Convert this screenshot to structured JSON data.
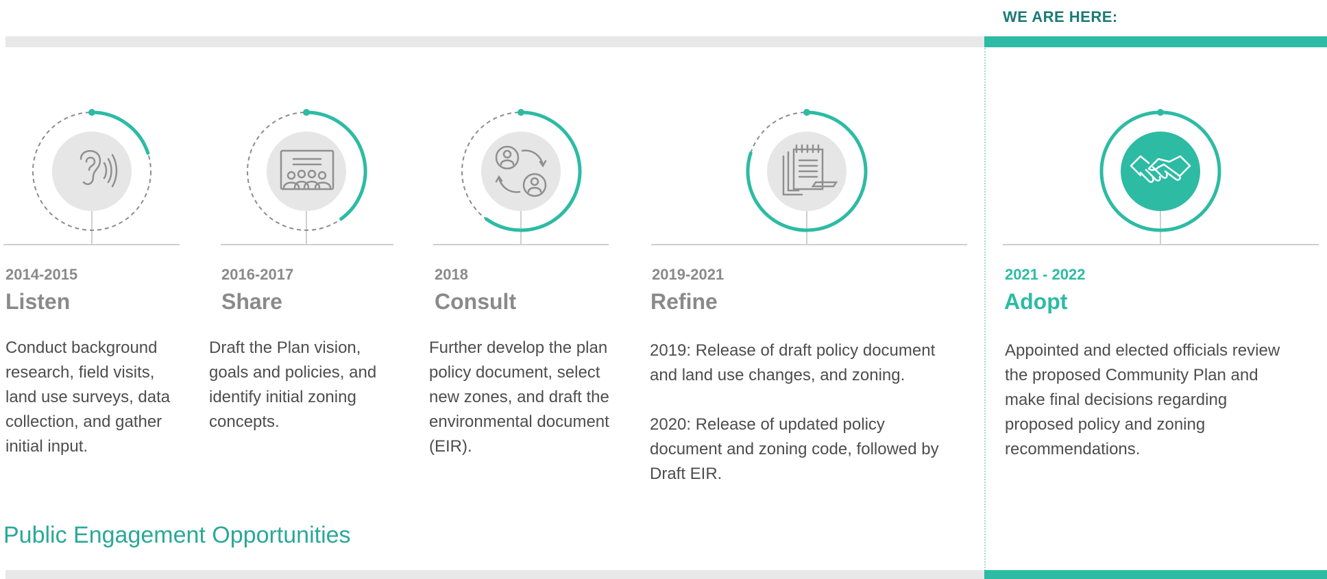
{
  "header": {
    "we_are_here": "WE ARE HERE:"
  },
  "stages": [
    {
      "years": "2014-2015",
      "title": "Listen",
      "icon": "ear-listen-icon",
      "description": "Conduct background research, field visits, land use surveys, data collection, and gather initial input.",
      "description_lines": [
        "Conduct background",
        "research, field visits,",
        "land use surveys, data",
        "collection, and gather",
        "initial input."
      ],
      "progress": 0.2,
      "active": false
    },
    {
      "years": "2016-2017",
      "title": "Share",
      "icon": "presentation-audience-icon",
      "description": "Draft the Plan vision, goals and policies, and identify initial zoning concepts.",
      "description_lines": [
        "Draft the Plan vision,",
        "goals and policies, and",
        "identify initial zoning",
        "concepts."
      ],
      "progress": 0.4,
      "active": false
    },
    {
      "years": "2018",
      "title": "Consult",
      "icon": "people-exchange-icon",
      "description": "Further develop the plan policy document, select new zones, and draft the environmental document (EIR).",
      "description_lines": [
        "Further develop the plan",
        "policy document, select",
        "new zones, and draft the",
        "environmental document",
        "(EIR)."
      ],
      "progress": 0.6,
      "active": false
    },
    {
      "years": "2019-2021",
      "title": "Refine",
      "icon": "notepad-document-icon",
      "description": "2019: Release of draft policy document and land use changes, and zoning. 2020: Release of updated policy document and zoning code, followed by Draft EIR.",
      "description_lines": [
        "2019: Release of draft policy document",
        "and land use changes, and zoning.",
        "",
        "2020: Release of updated policy",
        "document and zoning code, followed by",
        "Draft EIR."
      ],
      "progress": 0.8,
      "active": false
    },
    {
      "years": "2021 - 2022",
      "title": "Adopt",
      "icon": "handshake-icon",
      "description": "Appointed and elected officials review the proposed Community Plan and make final decisions regarding proposed policy and zoning recommendations.",
      "description_lines": [
        "Appointed and elected officials review",
        "the proposed Community Plan and",
        "make final decisions regarding",
        "proposed policy and zoning",
        "recommendations."
      ],
      "progress": 1.0,
      "active": true
    }
  ],
  "footer": {
    "section_heading": "Public Engagement Opportunities"
  },
  "colors": {
    "accent": "#2dbba4",
    "accent_dark": "#1b7a74",
    "muted_text": "#8a8a8a",
    "body_text": "#4d4d4d",
    "track_gray": "#e8e8e8"
  }
}
